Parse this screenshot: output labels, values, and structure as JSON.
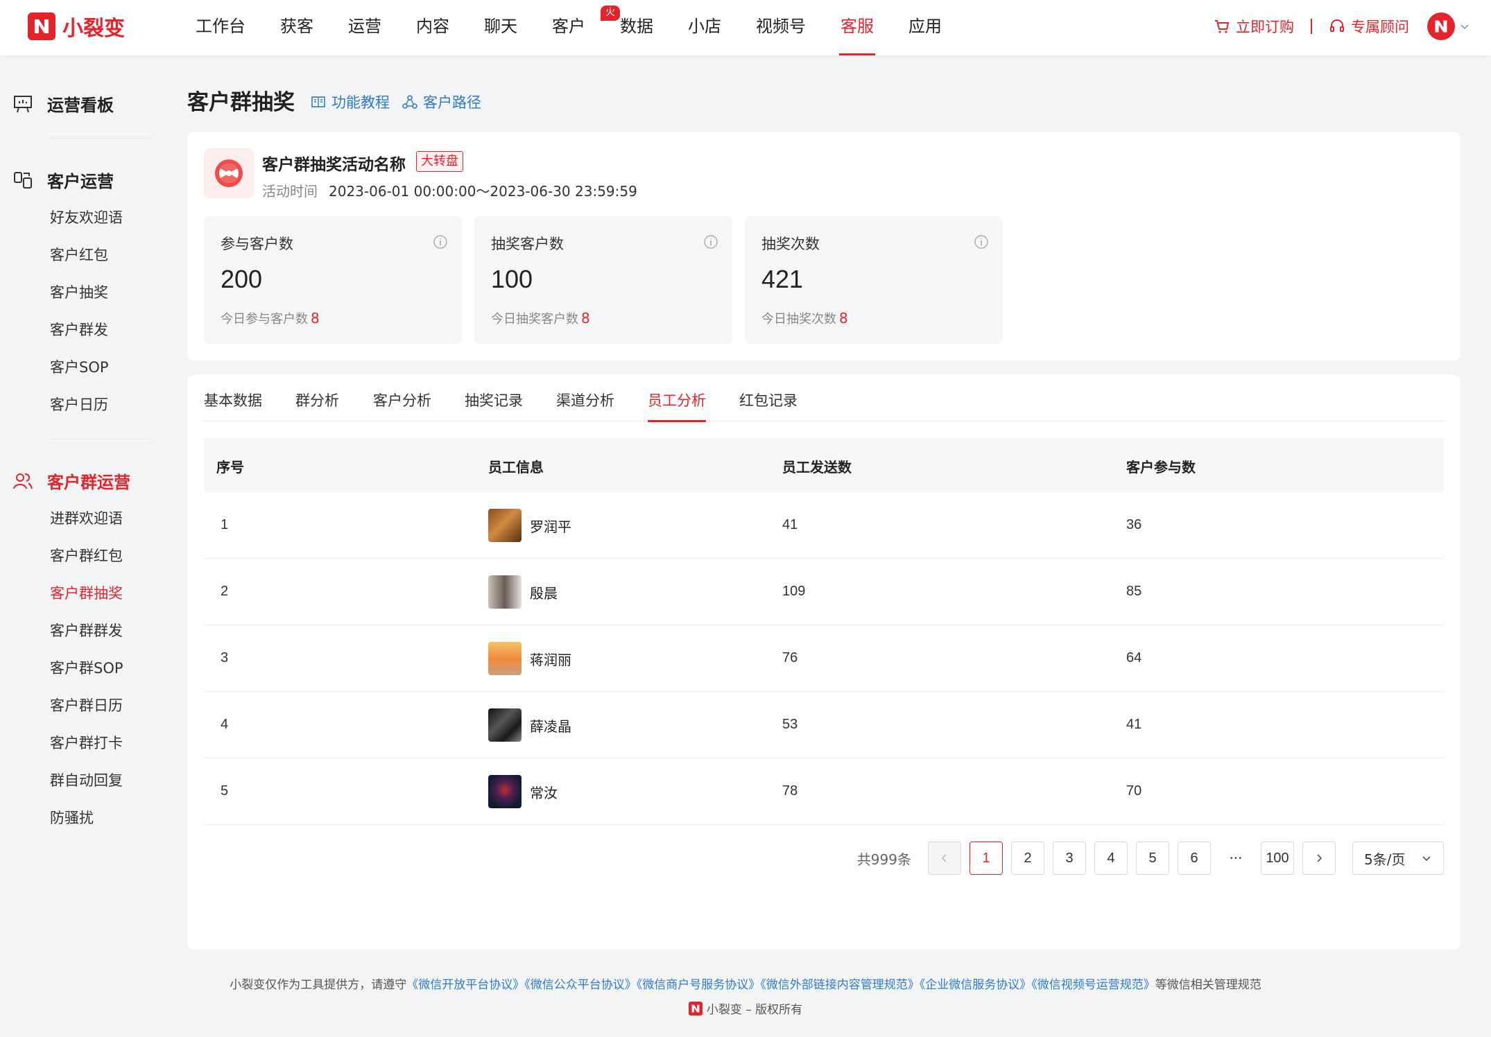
{
  "brand": {
    "name": "小裂变",
    "color": "#e5232b"
  },
  "nav": {
    "items": [
      "工作台",
      "获客",
      "运营",
      "内容",
      "聊天",
      "客户",
      "数据",
      "小店",
      "视频号",
      "客服",
      "应用"
    ],
    "active": "客服",
    "hot_badge": "火爆"
  },
  "top_right": {
    "order": "立即订购",
    "advisor": "专属顾问"
  },
  "sidebar": {
    "board": "运营看板",
    "customer_ops": "客户运营",
    "customer_items": [
      "好友欢迎语",
      "客户红包",
      "客户抽奖",
      "客户群发",
      "客户SOP",
      "客户日历"
    ],
    "group_ops": "客户群运营",
    "group_items": [
      "进群欢迎语",
      "客户群红包",
      "客户群抽奖",
      "客户群群发",
      "客户群SOP",
      "客户群日历",
      "客户群打卡",
      "群自动回复",
      "防骚扰"
    ],
    "active": "客户群抽奖"
  },
  "page": {
    "title": "客户群抽奖",
    "tutorial": "功能教程",
    "path": "客户路径"
  },
  "activity": {
    "name": "客户群抽奖活动名称",
    "tag": "大转盘",
    "time_label": "活动时间",
    "time": "2023-06-01 00:00:00～2023-06-30 23:59:59"
  },
  "stats": [
    {
      "label": "参与客户数",
      "value": "200",
      "sub": "今日参与客户数",
      "today": "8"
    },
    {
      "label": "抽奖客户数",
      "value": "100",
      "sub": "今日抽奖客户数",
      "today": "8"
    },
    {
      "label": "抽奖次数",
      "value": "421",
      "sub": "今日抽奖次数",
      "today": "8"
    }
  ],
  "tabs": [
    "基本数据",
    "群分析",
    "客户分析",
    "抽奖记录",
    "渠道分析",
    "员工分析",
    "红包记录"
  ],
  "active_tab": "员工分析",
  "table": {
    "headers": [
      "序号",
      "员工信息",
      "员工发送数",
      "客户参与数"
    ],
    "rows": [
      {
        "no": "1",
        "name": "罗润平",
        "sent": "41",
        "joined": "36"
      },
      {
        "no": "2",
        "name": "殷晨",
        "sent": "109",
        "joined": "85"
      },
      {
        "no": "3",
        "name": "蒋润丽",
        "sent": "76",
        "joined": "64"
      },
      {
        "no": "4",
        "name": "薛凌晶",
        "sent": "53",
        "joined": "41"
      },
      {
        "no": "5",
        "name": "常汝",
        "sent": "78",
        "joined": "70"
      }
    ]
  },
  "pagination": {
    "total": "共999条",
    "pages": [
      "1",
      "2",
      "3",
      "4",
      "5",
      "6"
    ],
    "dots": "···",
    "last": "100",
    "current": "1",
    "page_size": "5条/页"
  },
  "footer": {
    "prefix": "小裂变仅作为工具提供方，请遵守",
    "links": [
      "《微信开放平台协议》",
      "《微信公众平台协议》",
      "《微信商户号服务协议》",
      "《微信外部链接内容管理规范》",
      "《企业微信服务协议》",
      "《微信视频号运营规范》"
    ],
    "suffix": "等微信相关管理规范",
    "copyright": "小裂变 – 版权所有"
  }
}
